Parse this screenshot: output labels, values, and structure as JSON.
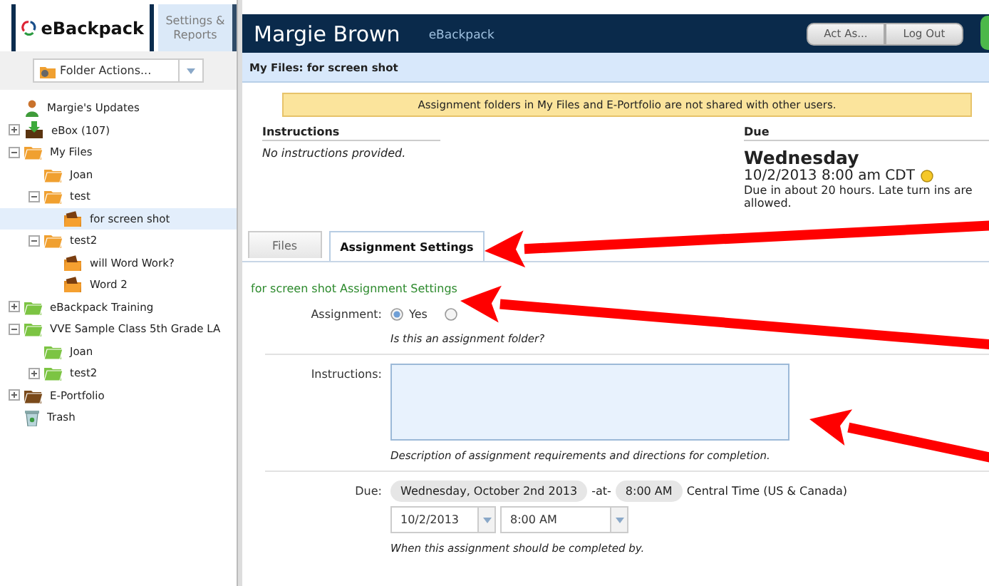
{
  "sidebar": {
    "tabs": [
      {
        "label": "eBackpack",
        "kind": "logo",
        "selected": true
      },
      {
        "label": "Settings & Reports",
        "kind": "text",
        "selected": false
      }
    ],
    "folder_actions": {
      "label": "Folder Actions..."
    },
    "tree": [
      {
        "label": "Margie's Updates",
        "kind": "person",
        "selected": false
      },
      {
        "label": "eBox (107)",
        "kind": "inbox",
        "expanded": false,
        "selected": false
      },
      {
        "label": "My Files",
        "kind": "folder",
        "color": "#f0a030",
        "expanded": true,
        "selected": false,
        "children": [
          {
            "label": "Joan",
            "kind": "folder",
            "color": "#f0a030",
            "selected": false
          },
          {
            "label": "test",
            "kind": "folder",
            "color": "#f0a030",
            "expanded": true,
            "selected": false,
            "children": [
              {
                "label": "for screen shot",
                "kind": "assignment",
                "selected": true
              }
            ]
          },
          {
            "label": "test2",
            "kind": "folder",
            "color": "#f0a030",
            "expanded": true,
            "selected": false,
            "children": [
              {
                "label": "will Word Work?",
                "kind": "assignment",
                "selected": false
              },
              {
                "label": "Word 2",
                "kind": "assignment",
                "selected": false
              }
            ]
          }
        ]
      },
      {
        "label": "eBackpack Training",
        "kind": "folder",
        "color": "#7cc443",
        "expanded": false,
        "selected": false
      },
      {
        "label": "VVE Sample Class 5th Grade LA",
        "kind": "folder",
        "color": "#7cc443",
        "expanded": true,
        "selected": false,
        "children": [
          {
            "label": "Joan",
            "kind": "folder",
            "color": "#7cc443",
            "selected": false
          },
          {
            "label": "test2",
            "kind": "folder",
            "color": "#7cc443",
            "expanded": false,
            "selected": false
          }
        ]
      },
      {
        "label": "E-Portfolio",
        "kind": "folder",
        "color": "#7a4a1a",
        "expanded": false,
        "selected": false
      },
      {
        "label": "Trash",
        "kind": "trash",
        "selected": false
      }
    ]
  },
  "header": {
    "user": "Margie Brown",
    "app": "eBackpack",
    "buttons": [
      "Act As...",
      "Log Out"
    ]
  },
  "breadcrumb": "My Files: for screen shot",
  "notice": "Assignment folders in My Files and E-Portfolio are not shared with other users.",
  "instructions": {
    "heading": "Instructions",
    "text": "No instructions provided."
  },
  "due": {
    "heading": "Due",
    "day": "Wednesday",
    "datetime": "10/2/2013 8:00 am CDT",
    "note": "Due in about 20 hours. Late turn ins are allowed."
  },
  "tabs": [
    {
      "label": "Files",
      "selected": false
    },
    {
      "label": "Assignment Settings",
      "selected": true
    }
  ],
  "settings": {
    "title": "for screen shot Assignment Settings",
    "fields": [
      {
        "kind": "radio",
        "label": "Assignment:",
        "options": [
          {
            "label": "Yes",
            "selected": true
          },
          {
            "selected": false
          }
        ],
        "hint": "Is this an assignment folder?"
      },
      {
        "kind": "textarea",
        "label": "Instructions:",
        "hint": "Description of assignment requirements and directions for completion."
      },
      {
        "kind": "due",
        "label": "Due:",
        "date_chip": "Wednesday, October 2nd 2013",
        "at": "-at-",
        "time_chip": "8:00 AM",
        "timezone": "Central Time (US & Canada)",
        "date_select": "10/2/2013",
        "time_select": "8:00 AM",
        "hint": "When this assignment should be completed by."
      }
    ]
  }
}
